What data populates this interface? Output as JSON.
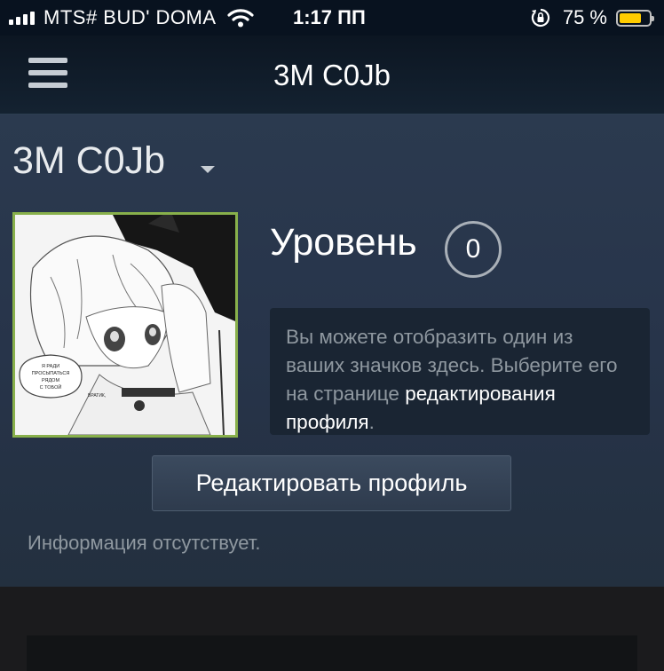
{
  "status_bar": {
    "carrier": "MTS# BUD' DOMA",
    "time": "1:17 ПП",
    "battery_percent": "75 %",
    "battery_level": 0.75,
    "icons": [
      "signal-icon",
      "wifi-icon",
      "rotation-lock-icon",
      "battery-icon"
    ],
    "battery_color": "#ffcc00"
  },
  "header": {
    "title": "3M C0Jb",
    "menu_icon": "hamburger-menu-icon"
  },
  "profile": {
    "name": "3M C0Jb",
    "avatar_border_color": "#88b04b",
    "avatar_text": "ВРАТИК! Я РАДИ ПРОСЫПАТЬСЯ РЯДОМ С ТОБОЙ",
    "level_label": "Уровень",
    "level_value": "0",
    "badge_text": "Вы можете отобразить один из ваших значков здесь. Выберите его на странице",
    "badge_link": "редактирования профиля",
    "badge_end": ".",
    "edit_button": "Редактировать профиль",
    "info": "Информация отсутствует."
  }
}
